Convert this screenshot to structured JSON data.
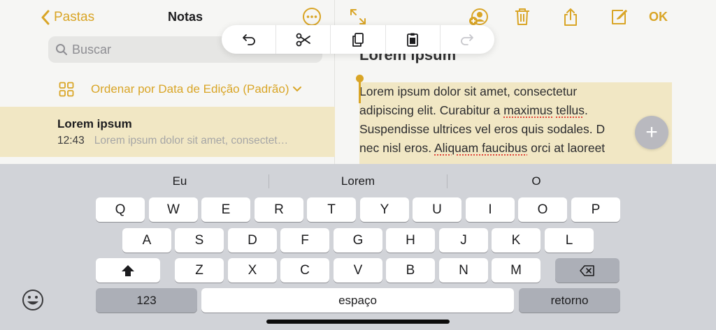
{
  "colors": {
    "accent": "#d9a526",
    "selection": "#f1e7c4",
    "keyboard_bg": "#d1d3d8"
  },
  "list_pane": {
    "back_label": "Pastas",
    "title": "Notas",
    "more_icon": "ellipsis-circle-icon",
    "search_placeholder": "Buscar",
    "sort_label": "Ordenar por Data de Edição (Padrão)",
    "notes": [
      {
        "title": "Lorem ipsum",
        "time": "12:43",
        "preview": "Lorem ipsum dolor sit amet, consectet…"
      }
    ]
  },
  "editor": {
    "toolbar_icons": [
      "expand-icon",
      "add-people-icon",
      "trash-icon",
      "share-icon",
      "compose-icon"
    ],
    "done_label": "OK",
    "heading": "Lorem ipsum",
    "body_lines": [
      "Lorem ipsum dolor sit amet, consectetur",
      "adipiscing elit. Curabitur a maximus tellus.",
      "Suspendisse ultrices vel eros quis sodales. D",
      "nec nisl eros. Aliquam faucibus orci at laoreet"
    ],
    "add_button": "+"
  },
  "edit_menu": [
    "undo-icon",
    "cut-icon",
    "copy-icon",
    "paste-icon",
    "redo-icon"
  ],
  "keyboard": {
    "predictions": [
      "Eu",
      "Lorem",
      "O"
    ],
    "row1": [
      "Q",
      "W",
      "E",
      "R",
      "T",
      "Y",
      "U",
      "I",
      "O",
      "P"
    ],
    "row2": [
      "A",
      "S",
      "D",
      "F",
      "G",
      "H",
      "J",
      "K",
      "L"
    ],
    "row3": [
      "Z",
      "X",
      "C",
      "V",
      "B",
      "N",
      "M"
    ],
    "numbers_label": "123",
    "space_label": "espaço",
    "return_label": "retorno"
  }
}
